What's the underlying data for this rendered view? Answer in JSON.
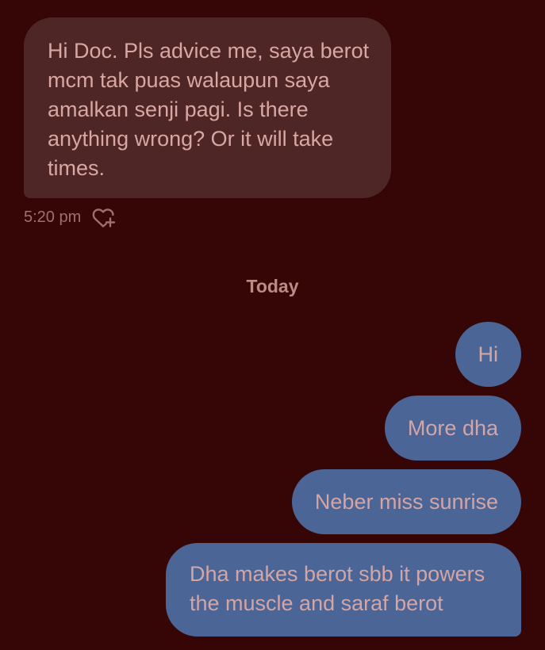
{
  "messages": {
    "incoming": [
      {
        "text": "Hi Doc. Pls advice me, saya berot mcm tak puas walaupun saya amalkan senji pagi. Is there anything wrong? Or it will take times.",
        "time": "5:20 pm"
      }
    ],
    "date_separator": "Today",
    "outgoing": [
      {
        "text": "Hi"
      },
      {
        "text": "More dha"
      },
      {
        "text": "Neber miss sunrise"
      },
      {
        "text": "Dha makes berot sbb it powers the muscle and saraf berot"
      }
    ]
  },
  "icons": {
    "react": "heart-plus-icon"
  },
  "colors": {
    "background": "#360606",
    "incoming_bubble": "#4f2626",
    "outgoing_bubble": "#4a6596",
    "text": "#d8a7a2"
  }
}
